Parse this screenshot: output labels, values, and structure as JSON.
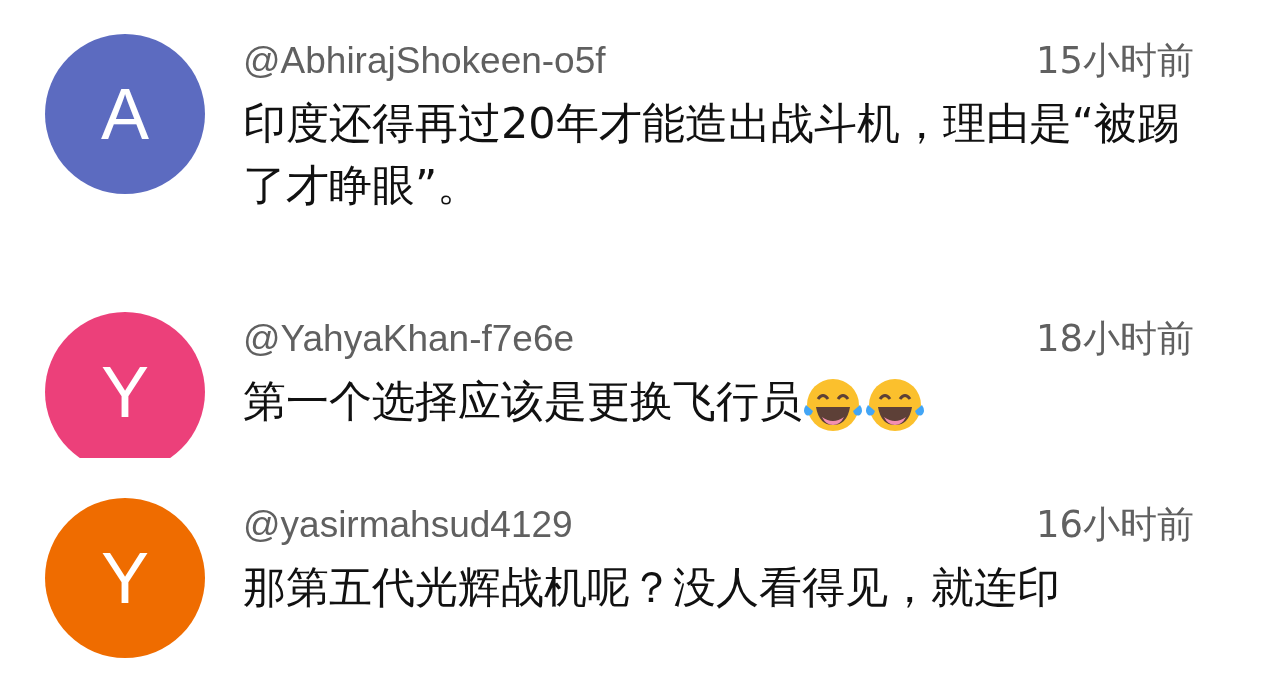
{
  "comments": [
    {
      "avatar": {
        "letter": "A",
        "color": "#5c6bc0"
      },
      "author": "@AbhirajShokeen-o5f",
      "time": "15小时前",
      "text": "印度还得再过20年才能造出战斗机，理由是“被踢了才睁眼”。"
    },
    {
      "avatar": {
        "letter": "Y",
        "color": "#ec407a"
      },
      "author": "@YahyaKhan-f7e6e",
      "time": "18小时前",
      "text": "第一个选择应该是更换飞行员",
      "emojis": [
        {
          "kind": "tears_of_joy"
        },
        {
          "kind": "tears_of_joy"
        }
      ]
    },
    {
      "avatar": {
        "letter": "Y",
        "color": "#ef6c00"
      },
      "author": "@yasirmahsud4129",
      "time": "16小时前",
      "text": "那第五代光辉战机呢？没人看得见，就连印"
    }
  ]
}
